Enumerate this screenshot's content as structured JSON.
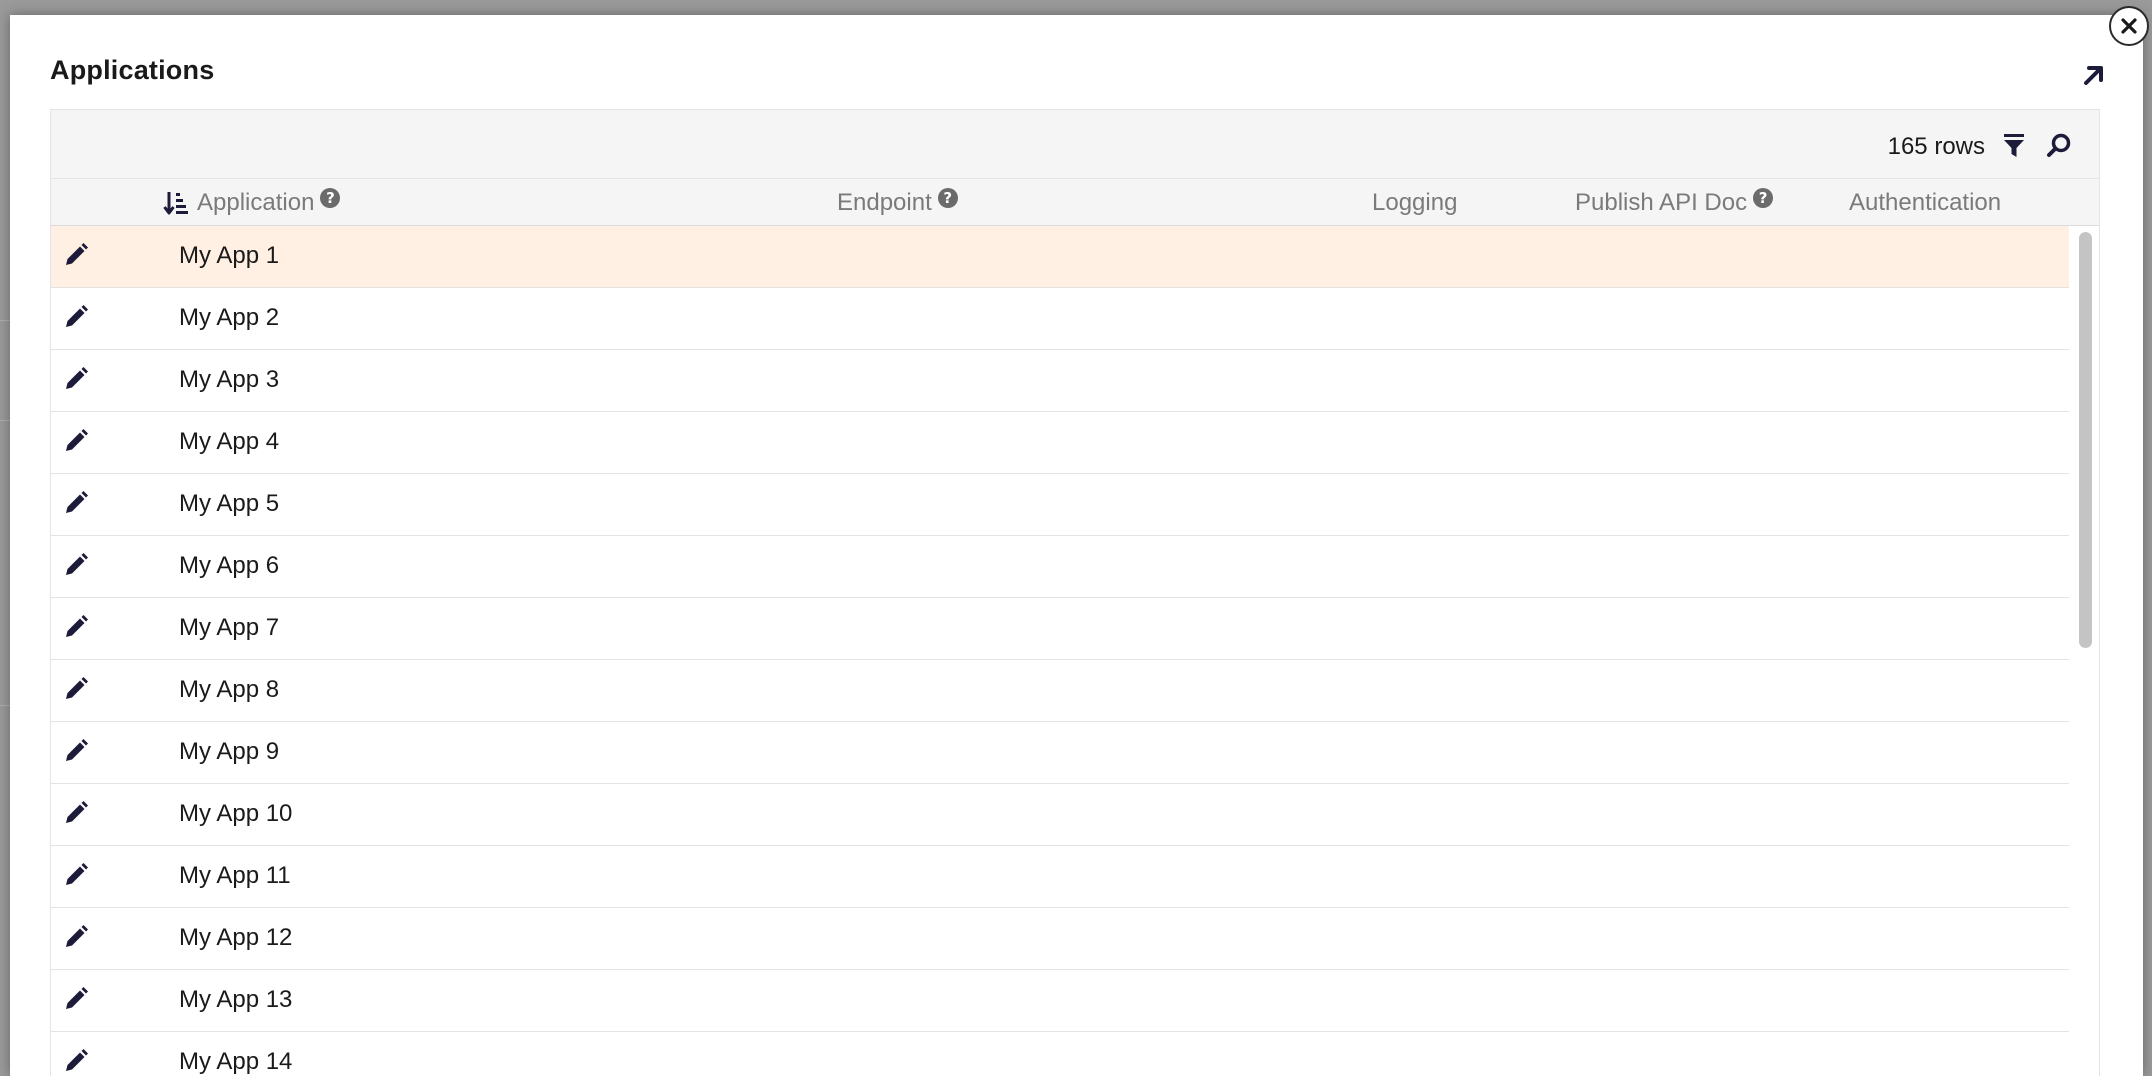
{
  "dialog": {
    "title": "Applications",
    "expand_icon": "arrow-up-right-icon",
    "close_icon": "close-icon"
  },
  "toolbar": {
    "row_count": "165 rows",
    "filter_icon": "filter-icon",
    "search_icon": "search-icon"
  },
  "columns": [
    {
      "label": "Application",
      "help": "?",
      "sort_icon": "sort-ascending-icon"
    },
    {
      "label": "Endpoint",
      "help": "?"
    },
    {
      "label": "Logging"
    },
    {
      "label": "Publish API Doc",
      "help": "?"
    },
    {
      "label": "Authentication"
    }
  ],
  "rows": [
    {
      "name": "My App 1",
      "selected": true
    },
    {
      "name": "My App 2"
    },
    {
      "name": "My App 3"
    },
    {
      "name": "My App 4"
    },
    {
      "name": "My App 5"
    },
    {
      "name": "My App 6"
    },
    {
      "name": "My App 7"
    },
    {
      "name": "My App 8"
    },
    {
      "name": "My App 9"
    },
    {
      "name": "My App 10"
    },
    {
      "name": "My App 11"
    },
    {
      "name": "My App 12"
    },
    {
      "name": "My App 13"
    },
    {
      "name": "My App 14"
    }
  ],
  "colors": {
    "selected_row": "#fff0e3",
    "header_bg": "#f5f5f5",
    "header_text": "#7a7a7a",
    "icon": "#1c1c3a"
  }
}
